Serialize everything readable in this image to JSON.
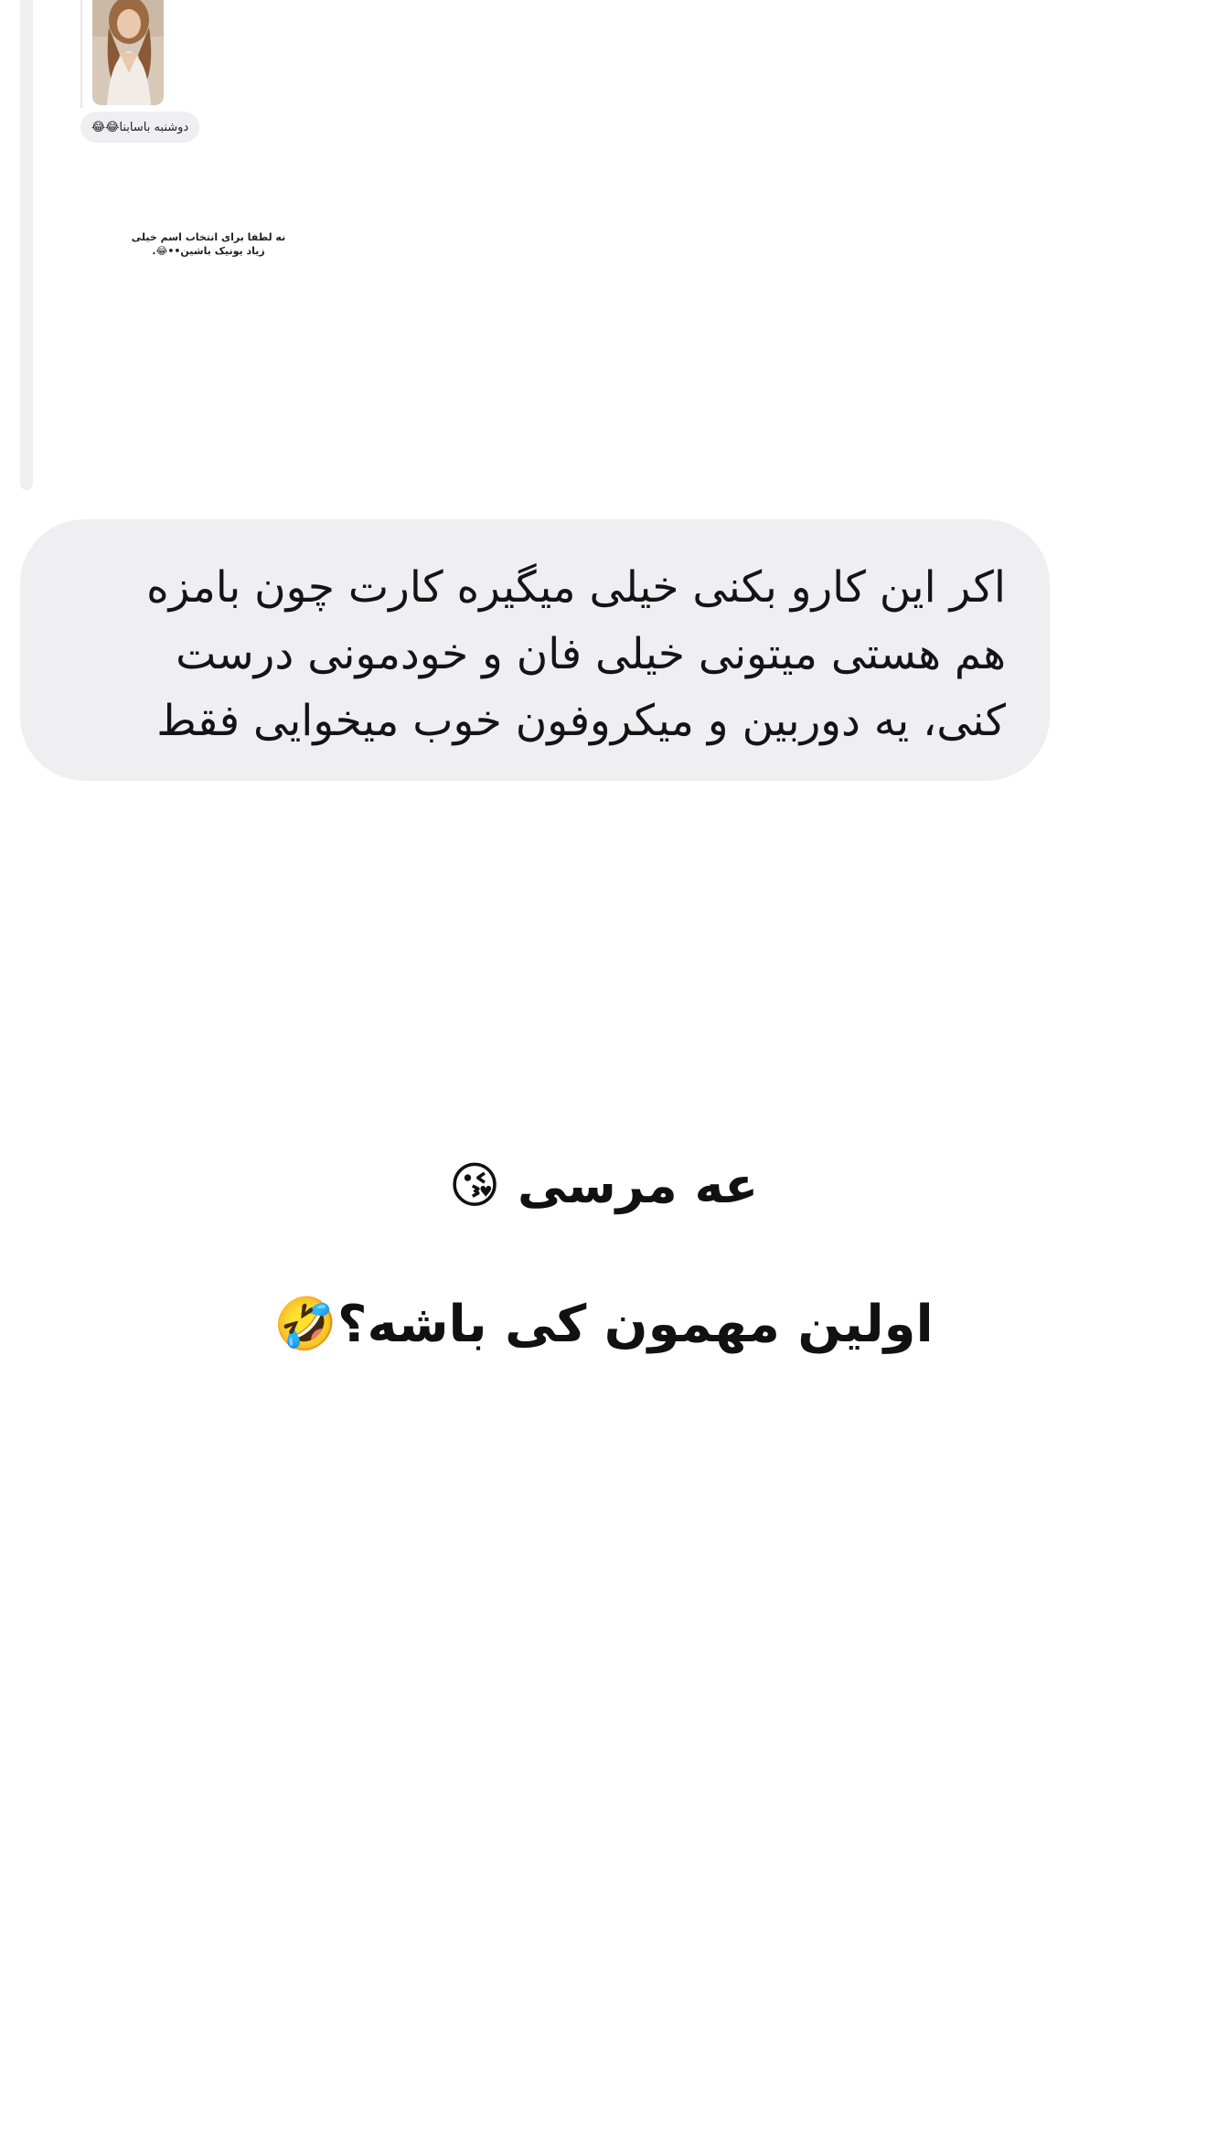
{
  "story_reply": {
    "chip_text": "دوشنبه باسابنا😂😂",
    "caption": "نه لطفا برای انتخاب اسم خیلی زیاد یونیک باشین••😂."
  },
  "message_bubble": {
    "lines": [
      "اکر این کارو بکنی خیلی میگیره کارت چون بامزه",
      "هم هستی میتونی خیلی فان و خودمونی درست",
      "کنی، یه دوربین و میکروفون خوب میخوایی فقط"
    ]
  },
  "caption_lines": {
    "line1": "عه مرسی 😘",
    "line2": "اولین مهمون کی باشه؟🤣"
  }
}
